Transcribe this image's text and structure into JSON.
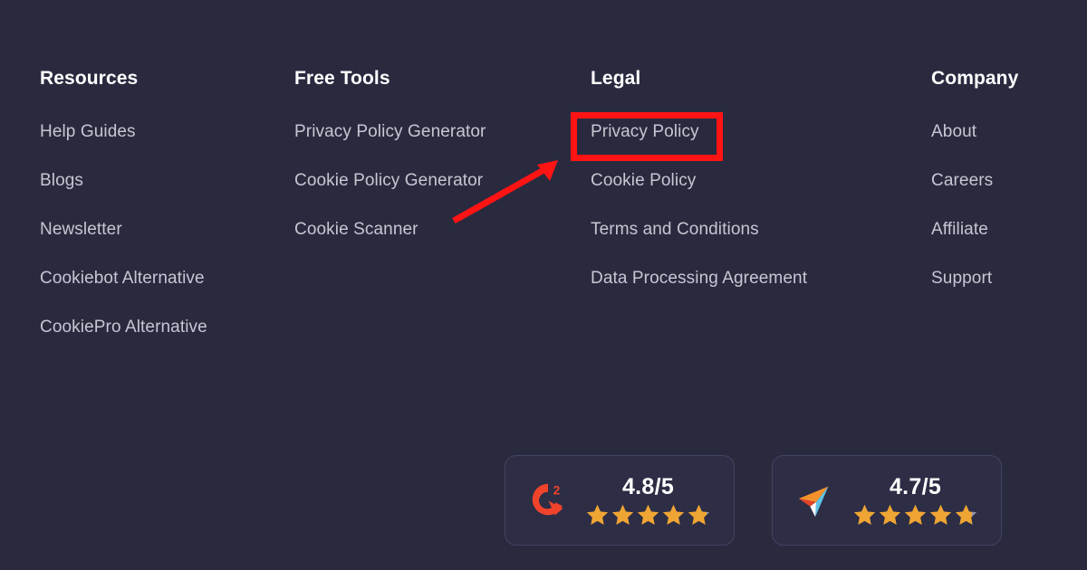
{
  "theme": {
    "background": "#2a2a3f",
    "heading_color": "#ffffff",
    "link_color": "#c6c7d2",
    "badge_background": "#2d2d45",
    "badge_border": "#434363",
    "annotation_color": "#ff1414",
    "star_color": "#efa534",
    "star_empty_color": "#8f94a8"
  },
  "footer": {
    "columns": [
      {
        "title": "Resources",
        "links": [
          "Help Guides",
          "Blogs",
          "Newsletter",
          "Cookiebot Alternative",
          "CookiePro Alternative"
        ]
      },
      {
        "title": "Free Tools",
        "links": [
          "Privacy Policy Generator",
          "Cookie Policy Generator",
          "Cookie Scanner"
        ]
      },
      {
        "title": "Legal",
        "links": [
          "Privacy Policy",
          "Cookie Policy",
          "Terms and Conditions",
          "Data Processing Agreement"
        ]
      },
      {
        "title": "Company",
        "links": [
          "About",
          "Careers",
          "Affiliate",
          "Support"
        ]
      }
    ]
  },
  "annotations": {
    "highlight": {
      "target_label": "Privacy Policy",
      "color": "#ff1414"
    },
    "arrow": {
      "color": "#ff1414",
      "points_to": "Privacy Policy"
    }
  },
  "ratings": [
    {
      "logo": "g2-logo-icon",
      "score": "4.8/5",
      "stars_filled": 5,
      "stars_total": 5
    },
    {
      "logo": "capterra-logo-icon",
      "score": "4.7/5",
      "stars_filled": 5,
      "stars_total": 5
    }
  ]
}
